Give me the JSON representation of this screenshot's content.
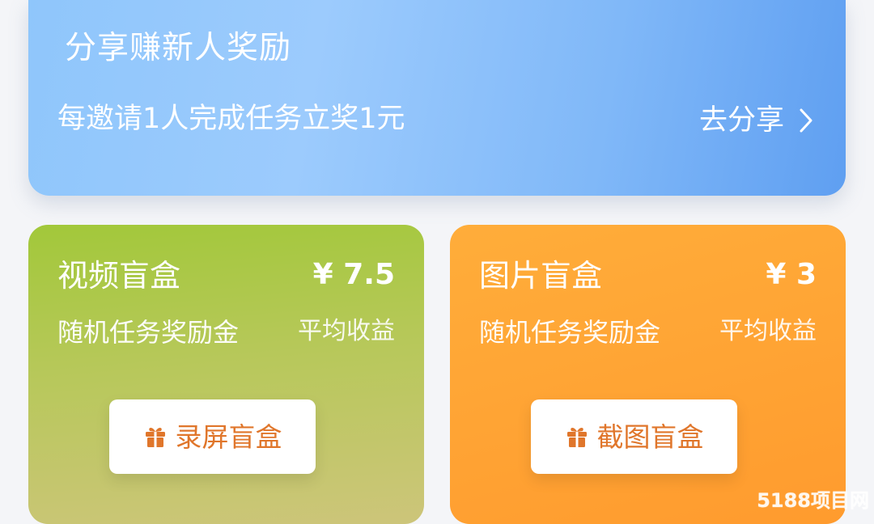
{
  "share_banner": {
    "title": "分享赚新人奖励",
    "description": "每邀请1人完成任务立奖1元",
    "link_label": "去分享",
    "link_icon": "chevron-right-icon"
  },
  "boxes": [
    {
      "title": "视频盲盒",
      "price": "¥ 7.5",
      "subtitle": "随机任务奖励金",
      "note": "平均收益",
      "button_label": "录屏盲盒",
      "button_icon": "gift-icon",
      "color": "#a8c743"
    },
    {
      "title": "图片盲盒",
      "price": "¥ 3",
      "subtitle": "随机任务奖励金",
      "note": "平均收益",
      "button_label": "截图盲盒",
      "button_icon": "gift-icon",
      "color": "#ffa434"
    }
  ],
  "button_text_color": "#e0762b",
  "watermark": "5188项目网"
}
